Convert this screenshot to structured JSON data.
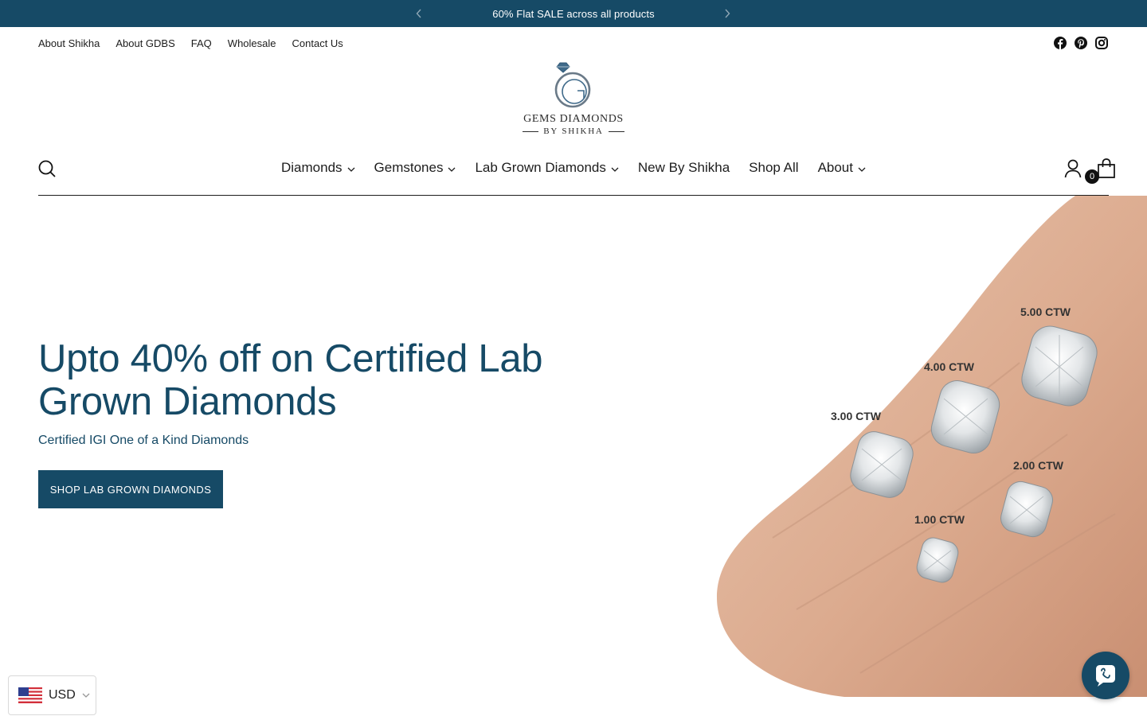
{
  "colors": {
    "brand": "#164a66",
    "text": "#1d1d1d",
    "background": "#ffffff"
  },
  "announcement": {
    "message": "60% Flat SALE across all products",
    "prev_icon": "chevron-left-icon",
    "next_icon": "chevron-right-icon"
  },
  "utility_links": [
    "About Shikha",
    "About GDBS",
    "FAQ",
    "Wholesale",
    "Contact Us"
  ],
  "social_icons": [
    "facebook-icon",
    "pinterest-icon",
    "instagram-icon"
  ],
  "logo": {
    "brand": "GEMS DIAMONDS",
    "tagline": "BY SHIKHA"
  },
  "nav": {
    "items": [
      {
        "label": "Diamonds",
        "has_dropdown": true
      },
      {
        "label": "Gemstones",
        "has_dropdown": true
      },
      {
        "label": "Lab Grown Diamonds",
        "has_dropdown": true
      },
      {
        "label": "New By Shikha",
        "has_dropdown": false
      },
      {
        "label": "Shop All",
        "has_dropdown": false
      },
      {
        "label": "About",
        "has_dropdown": true
      }
    ],
    "cart_count": "0"
  },
  "hero": {
    "title": "Upto 40% off on Certified Lab Grown Diamonds",
    "subtitle": "Certified IGI One of a Kind Diamonds",
    "cta": "SHOP LAB GROWN DIAMONDS",
    "image_labels": [
      "5.00 CTW",
      "4.00 CTW",
      "3.00 CTW",
      "2.00 CTW",
      "1.00 CTW"
    ]
  },
  "currency": {
    "code": "USD",
    "flag_icon": "us-flag-icon"
  },
  "chat": {
    "icon": "chat-icon"
  }
}
